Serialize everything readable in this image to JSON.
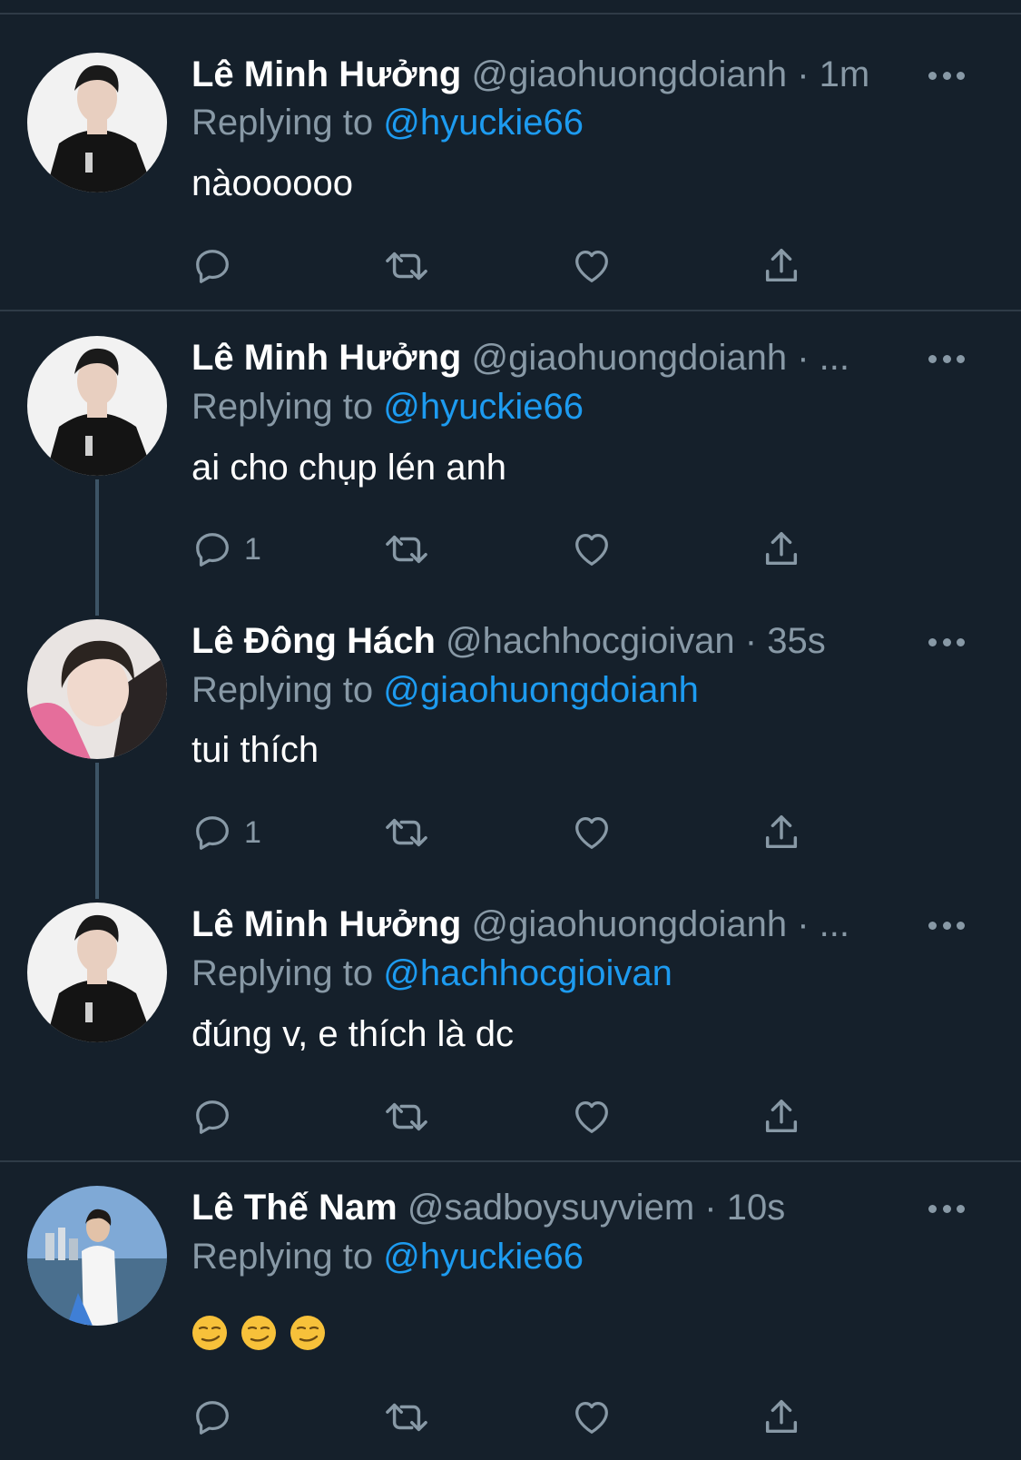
{
  "colors": {
    "background": "#15202b",
    "divider": "#2f3b47",
    "secondary_text": "#8899a6",
    "mention": "#1d9bf0",
    "thread_line": "#3d5466"
  },
  "tweets": [
    {
      "name": "Lê Minh Hưởng",
      "handle": "@giaohuongdoianh",
      "dot": "·",
      "time": "1m",
      "replying_prefix": "Replying to",
      "replying_to": "@hyuckie66",
      "text": "nàoooooo",
      "reply_count": "",
      "avatar_icon": "avatar-black-hoodie"
    },
    {
      "name": "Lê Minh Hưởng",
      "handle": "@giaohuongdoianh",
      "dot": "·",
      "time": "...",
      "replying_prefix": "Replying to",
      "replying_to": "@hyuckie66",
      "text": "ai cho chụp lén anh",
      "reply_count": "1",
      "avatar_icon": "avatar-black-hoodie"
    },
    {
      "name": "Lê Đông Hách",
      "handle": "@hachhocgioivan",
      "dot": "·",
      "time": "35s",
      "replying_prefix": "Replying to",
      "replying_to": "@giaohuongdoianh",
      "text": "tui thích",
      "reply_count": "1",
      "avatar_icon": "avatar-pink-hoodie"
    },
    {
      "name": "Lê Minh Hưởng",
      "handle": "@giaohuongdoianh",
      "dot": "·",
      "time": "...",
      "replying_prefix": "Replying to",
      "replying_to": "@hachhocgioivan",
      "text": "đúng v, e thích là dc",
      "reply_count": "",
      "avatar_icon": "avatar-black-hoodie"
    },
    {
      "name": "Lê Thế Nam",
      "handle": "@sadboysuyviem",
      "dot": "·",
      "time": "10s",
      "replying_prefix": "Replying to",
      "replying_to": "@hyuckie66",
      "text": "",
      "emojis": [
        "smirk-emoji",
        "smirk-emoji",
        "smirk-emoji"
      ],
      "reply_count": "",
      "avatar_icon": "avatar-seaside"
    }
  ]
}
